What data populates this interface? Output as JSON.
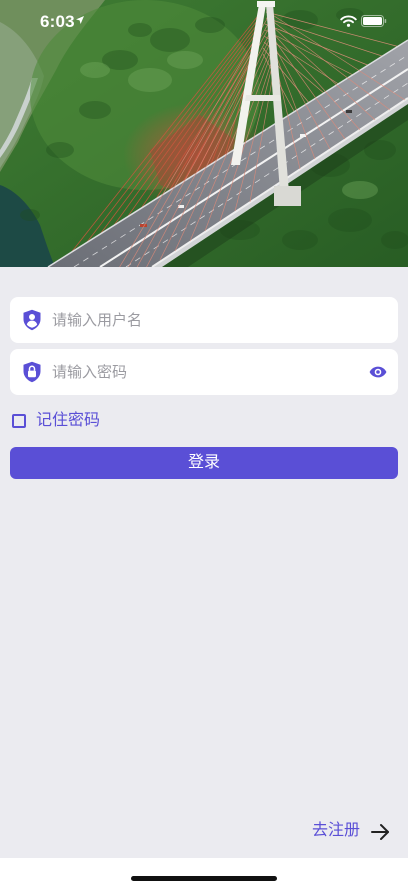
{
  "status_bar": {
    "time": "6:03",
    "icons": [
      "location-arrow-icon",
      "wifi-icon",
      "battery-icon"
    ]
  },
  "login_form": {
    "username": {
      "icon": "user-shield-icon",
      "placeholder": "请输入用户名",
      "value": ""
    },
    "password": {
      "icon": "lock-shield-icon",
      "placeholder": "请输入密码",
      "value": "",
      "toggle_icon": "eye-icon"
    },
    "remember_password": {
      "label": "记住密码",
      "checked": false
    },
    "submit_label": "登录"
  },
  "footer": {
    "register_label": "去注册",
    "register_icon": "arrow-right-icon"
  },
  "colors": {
    "accent": "#5a4fd6",
    "background": "#ebebf0",
    "surface": "#ffffff",
    "placeholder": "#9b9ba1"
  }
}
